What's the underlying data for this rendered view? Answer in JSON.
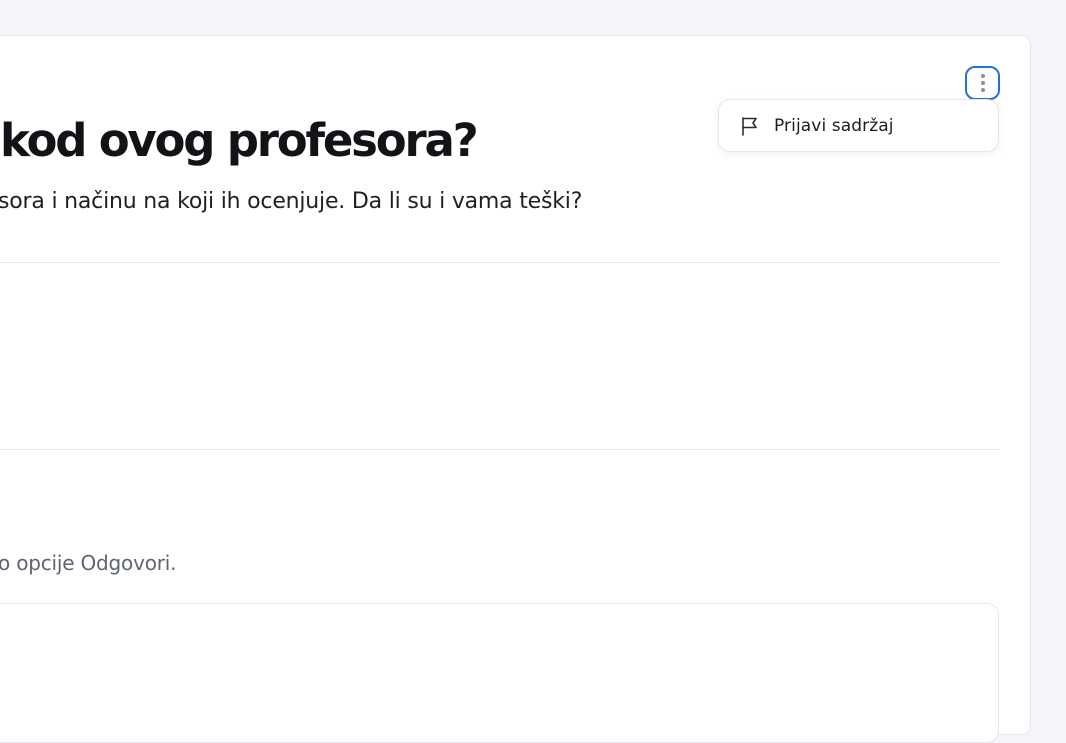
{
  "post": {
    "title": "kod ovog profesora?",
    "body": "sora i načinu na koji ih ocenjuje. Da li su i vama teški?"
  },
  "menu": {
    "items": [
      {
        "label": "Prijavi sadržaj",
        "icon": "flag-icon"
      }
    ]
  },
  "more_button": {
    "icon": "more-vertical-icon"
  },
  "reply": {
    "hint": "o opcije Odgovori."
  },
  "colors": {
    "accent_focus": "#2a6fd6",
    "background": "#f4f5f8",
    "card": "#ffffff"
  }
}
